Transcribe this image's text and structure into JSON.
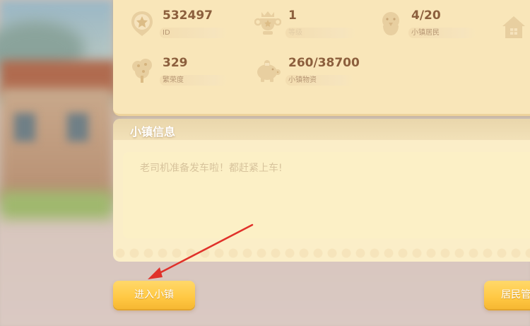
{
  "stats": {
    "id": {
      "value": "532497",
      "label": "ID"
    },
    "level": {
      "value": "1",
      "label": "等级"
    },
    "residents": {
      "value": "4/20",
      "label": "小镇居民"
    },
    "prosperity": {
      "value": "329",
      "label": "繁荣度"
    },
    "supplies": {
      "value": "260/38700",
      "label": "小镇物资"
    }
  },
  "info": {
    "title": "小镇信息",
    "message": "老司机准备发车啦！都赶紧上车!"
  },
  "buttons": {
    "enter": "进入小镇",
    "residents": "居民管"
  },
  "colors": {
    "panel": "#f9e6b9",
    "text_value": "#8c5f3d",
    "button": "#ffc843",
    "arrow": "#e0312a"
  }
}
